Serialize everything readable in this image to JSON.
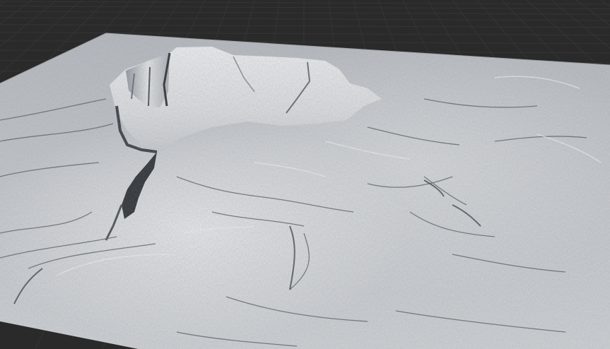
{
  "viewport": {
    "background_color": "#2a2a2b",
    "grid_line_color": "#353536",
    "terrain_base_color": "#c9ccd0",
    "terrain_highlight_color": "#eef0f1",
    "terrain_shadow_color": "#5f656b",
    "terrain_deep_shadow_color": "#2c3034"
  }
}
